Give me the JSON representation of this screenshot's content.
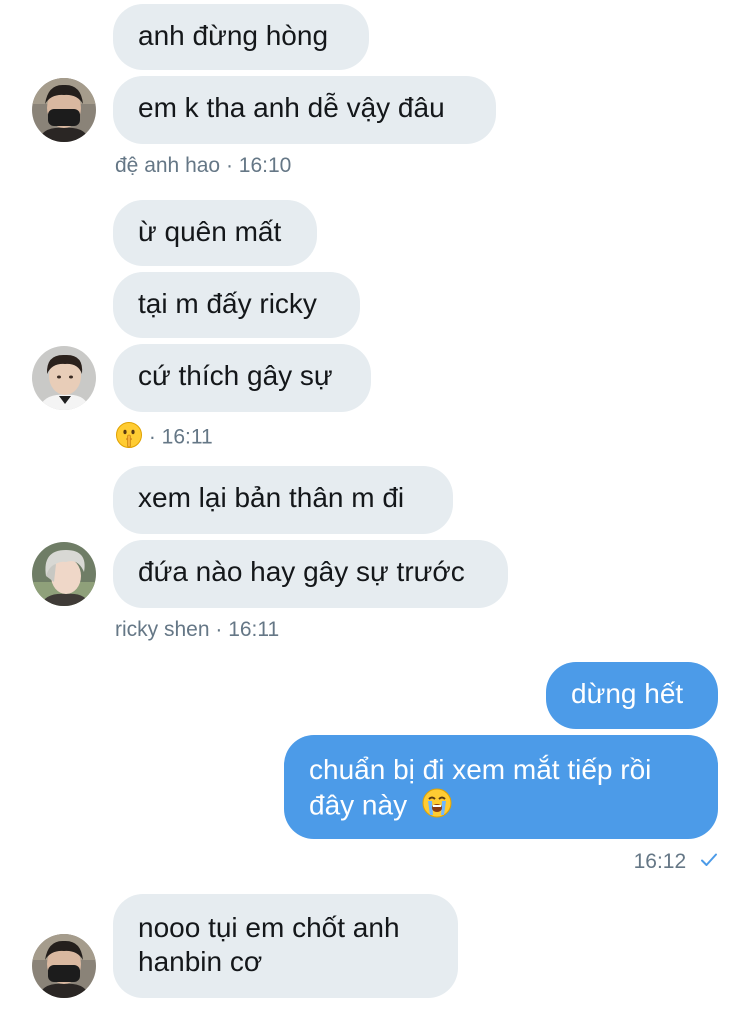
{
  "conversation": {
    "messages": [
      {
        "text": "anh đừng hòng"
      },
      {
        "text": "em k tha anh dễ vậy đâu"
      },
      {
        "text": "ừ quên mất"
      },
      {
        "text": "tại m đấy ricky"
      },
      {
        "text": "cứ thích gây sự"
      },
      {
        "text": "xem lại bản thân m đi"
      },
      {
        "text": "đứa nào hay gây sự trước"
      },
      {
        "text": "dừng hết"
      },
      {
        "line1": "chuẩn bị đi xem mắt tiếp rồi",
        "line2": "đây này"
      },
      {
        "line1": "nooo tụi em chốt anh",
        "line2": "hanbin cơ"
      }
    ],
    "meta": [
      {
        "sender": "đệ anh hao",
        "time": "· 16:10"
      },
      {
        "sender_icon": "shushing-face-emoji",
        "time": "· 16:11"
      },
      {
        "sender": "ricky shen",
        "time": "· 16:11"
      },
      {
        "time": "16:12",
        "status_icon": "read-checkmark-icon"
      }
    ],
    "avatars": [
      {
        "icon": "masked-user-avatar"
      },
      {
        "icon": "user-avatar"
      },
      {
        "icon": "silver-hair-user-avatar"
      },
      {
        "icon": "masked-user-avatar"
      }
    ]
  },
  "colors": {
    "incoming_bubble": "#e6ecf0",
    "outgoing_bubble": "#4c9be8",
    "meta_text": "#657786",
    "check": "#4c9be8"
  }
}
